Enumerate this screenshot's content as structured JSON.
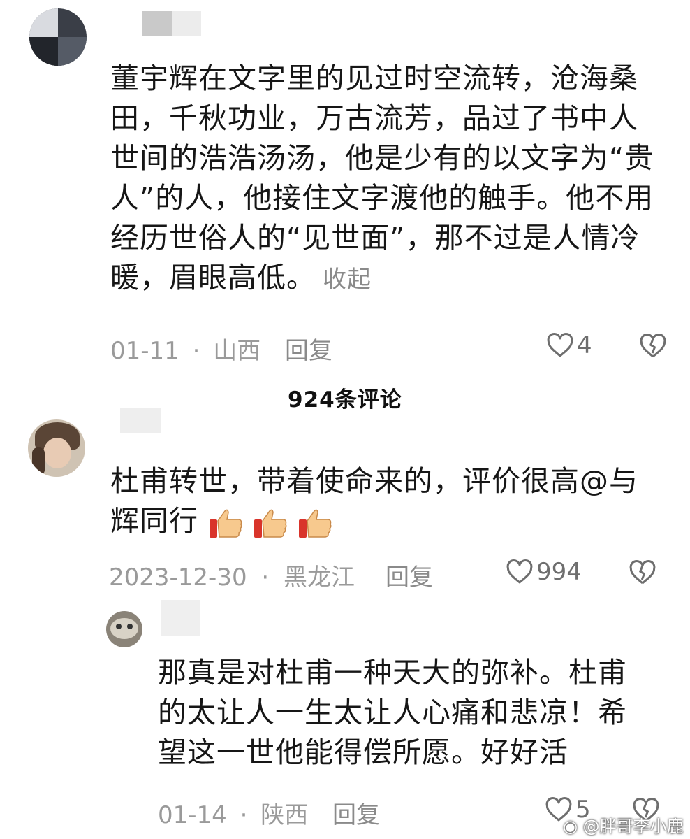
{
  "comments": [
    {
      "lines": [
        "董宇辉在文字里的见过时空流转，沧海桑",
        "田，千秋功业，万古流芳，品过了书中人",
        "世间的浩浩汤汤，他是少有的以文字为“贵",
        "人”的人，他接住文字渡他的触手。他不用",
        "经历世俗人的“见世面”，那不过是人情冷",
        "暖，眉眼高低。"
      ],
      "collapse_label": "收起",
      "date": "01-11",
      "location": "山西",
      "reply_label": "回复",
      "like_count": "4"
    },
    {
      "lines": [
        "杜甫转世，带着使命来的，评价很高@与",
        "辉同行"
      ],
      "date": "2023-12-30",
      "location": "黑龙江",
      "reply_label": "回复",
      "like_count": "994"
    },
    {
      "lines": [
        "那真是对杜甫一种天大的弥补。杜甫",
        "的太让人一生太让人心痛和悲凉！希",
        "望这一世他能得偿所愿。好好活"
      ],
      "date": "01-14",
      "location": "陕西",
      "reply_label": "回复",
      "like_count": "5"
    }
  ],
  "comment_count_label": "924条评论",
  "dot_separator": "·",
  "watermark": "@胖哥李小鹿",
  "icons": {
    "like": "heart-outline-icon",
    "dislike": "broken-heart-icon",
    "emoji": "thumbs-up-emoji"
  }
}
